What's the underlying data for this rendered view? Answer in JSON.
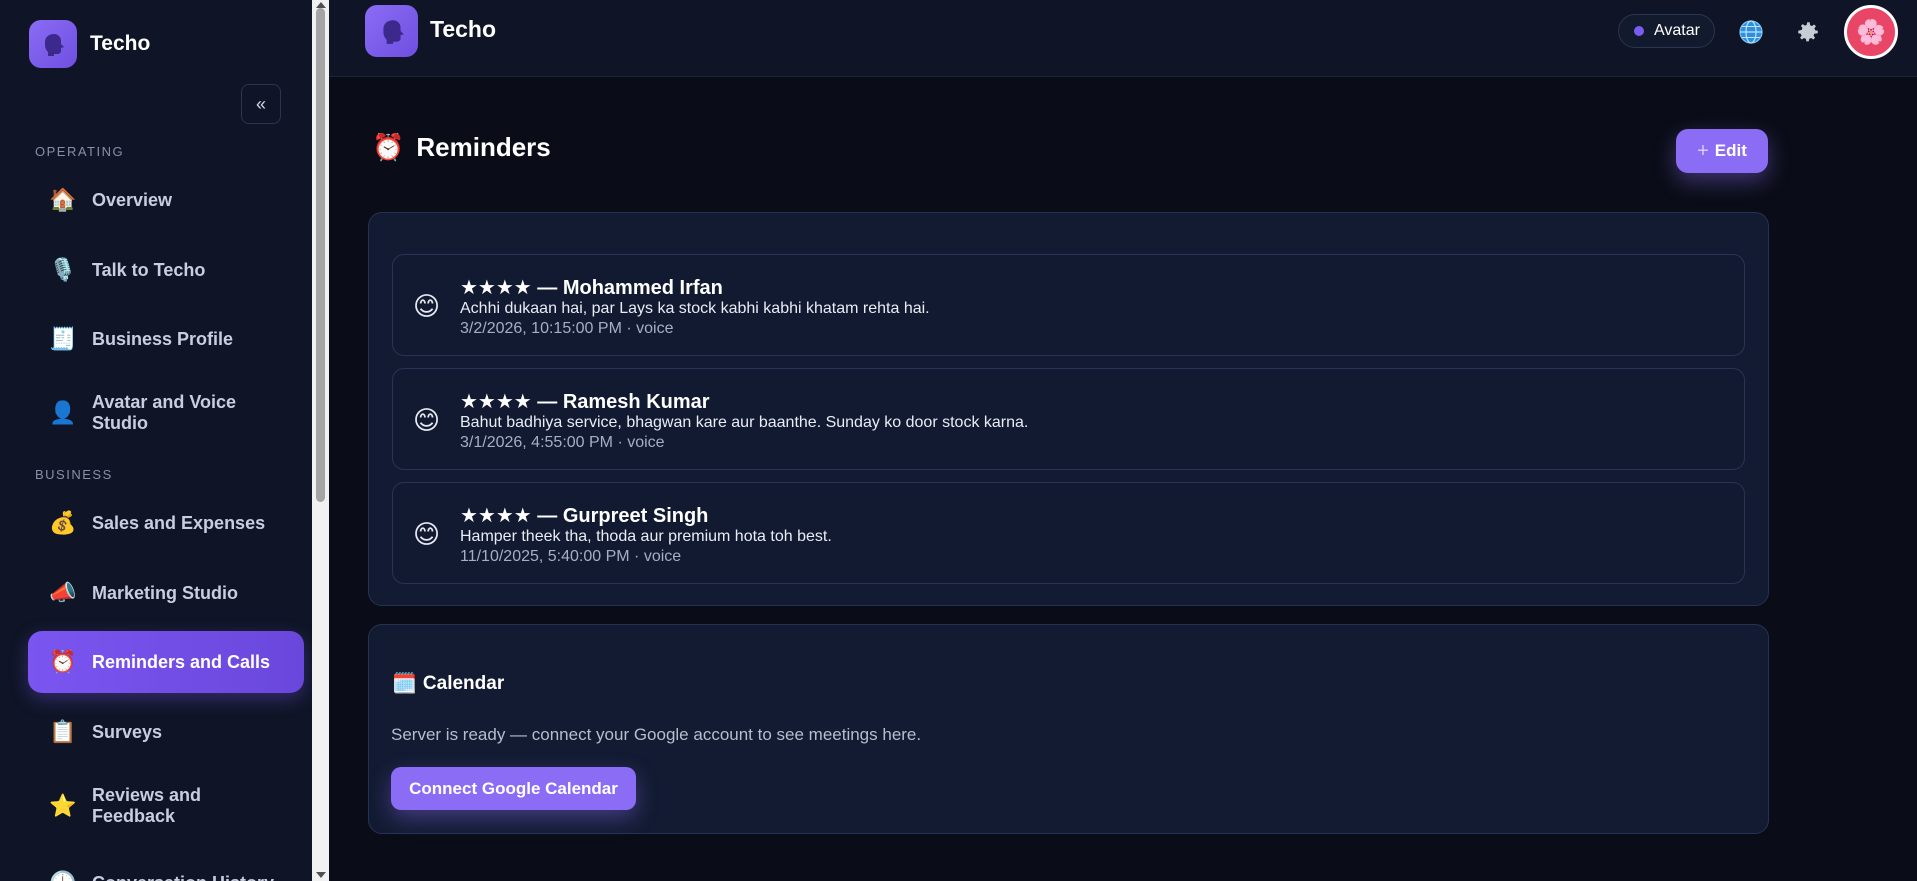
{
  "app": {
    "name": "Techo"
  },
  "sidebar": {
    "collapse_icon": "«",
    "sections": [
      {
        "label": "OPERATING"
      },
      {
        "label": "BUSINESS"
      }
    ],
    "items": [
      {
        "label": "Overview",
        "icon": "🏠",
        "icon_name": "house-icon"
      },
      {
        "label": "Talk to Techo",
        "icon": "🎙️",
        "icon_name": "microphone-icon"
      },
      {
        "label": "Business Profile",
        "icon": "🧾",
        "icon_name": "receipt-icon"
      },
      {
        "label": "Avatar and Voice Studio",
        "icon": "👤",
        "icon_name": "person-icon"
      },
      {
        "label": "Sales and Expenses",
        "icon": "💰",
        "icon_name": "money-bag-icon"
      },
      {
        "label": "Marketing Studio",
        "icon": "📣",
        "icon_name": "megaphone-icon"
      },
      {
        "label": "Reminders and Calls",
        "icon": "⏰",
        "icon_name": "alarm-clock-icon",
        "active": true
      },
      {
        "label": "Surveys",
        "icon": "📋",
        "icon_name": "clipboard-icon"
      },
      {
        "label": "Reviews and Feedback",
        "icon": "⭐",
        "icon_name": "star-icon"
      },
      {
        "label": "Conversation History",
        "icon": "🕒",
        "icon_name": "clock-icon"
      }
    ]
  },
  "topbar": {
    "title": "Techo",
    "avatar_pill": "Avatar",
    "accent_color": "#7b5cf2"
  },
  "main": {
    "title": "Reminders",
    "title_icon": "⏰",
    "edit_label": "Edit",
    "edit_icon": "+",
    "reviews": [
      {
        "title": "★★★★ — Mohammed Irfan",
        "text": "Achhi dukaan hai, par Lays ka stock kabhi kabhi khatam rehta hai.",
        "meta": "3/2/2026, 10:15:00 PM · voice",
        "emoji": "😊"
      },
      {
        "title": "★★★★ — Ramesh Kumar",
        "text": "Bahut badhiya service, bhagwan kare aur baanthe. Sunday ko door stock karna.",
        "meta": "3/1/2026, 4:55:00 PM · voice",
        "emoji": "😊"
      },
      {
        "title": "★★★★ — Gurpreet Singh",
        "text": "Hamper theek tha, thoda aur premium hota toh best.",
        "meta": "11/10/2025, 5:40:00 PM · voice",
        "emoji": "😊"
      }
    ],
    "calendar": {
      "title": "Calendar",
      "icon": "🗓️",
      "text": "Server is ready — connect your Google account to see meetings here.",
      "button_label": "Connect Google Calendar"
    }
  }
}
